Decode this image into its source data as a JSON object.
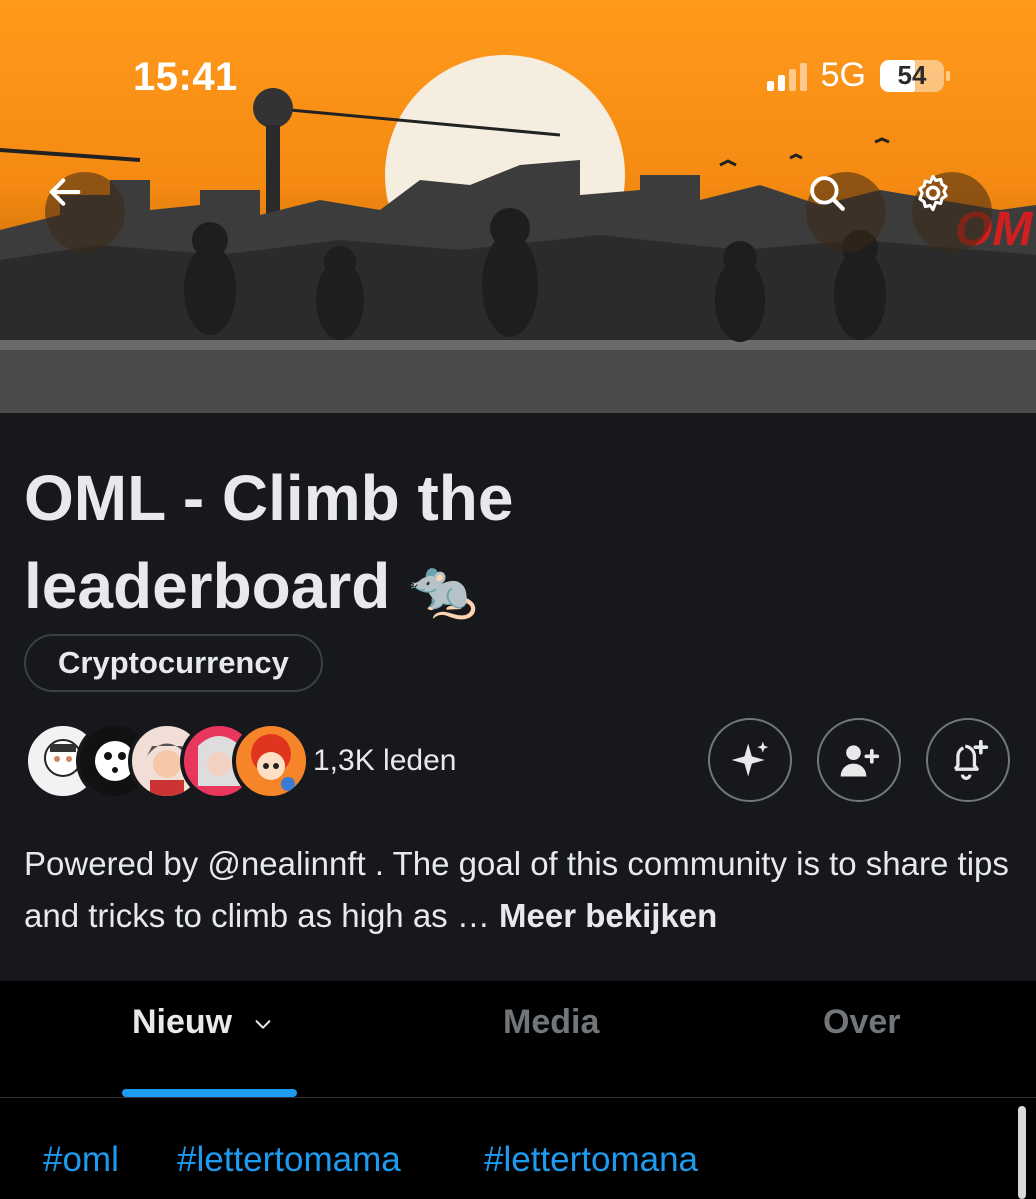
{
  "status_bar": {
    "time": "15:41",
    "network": "5G",
    "battery": "54",
    "battery_level": 0.54
  },
  "header": {
    "back_icon": "arrow-left-icon",
    "search_icon": "search-icon",
    "settings_icon": "gear-icon"
  },
  "community": {
    "title": "OML - Climb the leaderboard",
    "title_emoji": "🐀",
    "category": "Cryptocurrency",
    "members": "1,3K leden",
    "description": "Powered by @nealinnft . The goal of this community is to share tips and tricks to climb as high as …",
    "more_label": "Meer bekijken"
  },
  "actions": [
    "sparkle-icon",
    "add-user-icon",
    "bell-plus-icon"
  ],
  "tabs": [
    {
      "label": "Nieuw",
      "active": true
    },
    {
      "label": "Media",
      "active": false
    },
    {
      "label": "Over",
      "active": false
    }
  ],
  "hashtags": [
    "#oml",
    "#lettertomama",
    "#lettertomana"
  ],
  "colors": {
    "accent": "#1d9bf0",
    "banner_orange": "#f48a12",
    "background": "#16181c"
  }
}
